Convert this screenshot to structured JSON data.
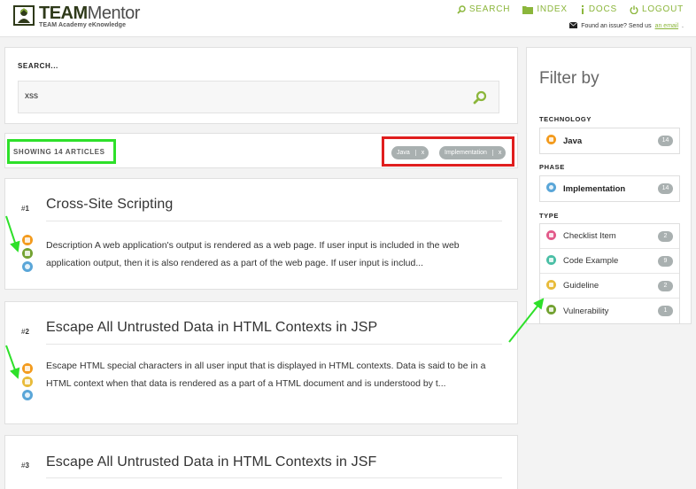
{
  "header": {
    "logo_team": "TEAM",
    "logo_mentor": "Mentor",
    "logo_subtitle": "TEAM Academy eKnowledge",
    "nav": [
      {
        "label": "SEARCH",
        "icon": "search-icon"
      },
      {
        "label": "INDEX",
        "icon": "folder-icon"
      },
      {
        "label": "DOCS",
        "icon": "info-icon"
      },
      {
        "label": "LOGOUT",
        "icon": "power-icon"
      }
    ],
    "issue_text": "Found an issue? Send us",
    "issue_link": "an email",
    "issue_end": "."
  },
  "search": {
    "label": "SEARCH...",
    "value": "xss"
  },
  "results": {
    "showing": "SHOWING 14 ARTICLES",
    "chips": [
      {
        "label": "Java",
        "close": "x"
      },
      {
        "label": "Implementation",
        "close": "x"
      }
    ]
  },
  "articles": [
    {
      "num_prefix": "#",
      "num": "1",
      "title": "Cross-Site Scripting",
      "description": "Description A web application's output is rendered as a web page. If user input is included in the web application output, then it is also rendered as a part of the web page. If user input is includ...",
      "icons": [
        "java-icon",
        "vulnerability-icon",
        "implementation-icon"
      ]
    },
    {
      "num_prefix": "#",
      "num": "2",
      "title": "Escape All Untrusted Data in HTML Contexts in JSP",
      "description": "Escape HTML special characters in all user input that is displayed in HTML contexts. Data is said to be in a HTML context when that data is rendered as a part of a HTML document and is understood by t...",
      "icons": [
        "java-icon",
        "guideline-icon",
        "implementation-icon"
      ]
    },
    {
      "num_prefix": "#",
      "num": "3",
      "title": "Escape All Untrusted Data in HTML Contexts in JSF"
    }
  ],
  "sidebar": {
    "title": "Filter by",
    "technology": {
      "label": "TECHNOLOGY",
      "items": [
        {
          "label": "Java",
          "count": "14",
          "icon": "java-icon"
        }
      ]
    },
    "phase": {
      "label": "PHASE",
      "items": [
        {
          "label": "Implementation",
          "count": "14",
          "icon": "implementation-icon"
        }
      ]
    },
    "type": {
      "label": "TYPE",
      "items": [
        {
          "label": "Checklist Item",
          "count": "2",
          "icon": "checklist-icon"
        },
        {
          "label": "Code Example",
          "count": "9",
          "icon": "code-icon"
        },
        {
          "label": "Guideline",
          "count": "2",
          "icon": "guideline-icon"
        },
        {
          "label": "Vulnerability",
          "count": "1",
          "icon": "vulnerability-icon"
        }
      ]
    }
  },
  "colors": {
    "accent": "#8bb63b",
    "highlight_green": "#2ee02a",
    "highlight_red": "#e01e1e",
    "java": "#f39b1e",
    "vulnerability": "#73a232",
    "guideline": "#e8bb3a",
    "implementation": "#5aa6d8",
    "checklist": "#e25a8a",
    "code": "#4bbfa6"
  }
}
